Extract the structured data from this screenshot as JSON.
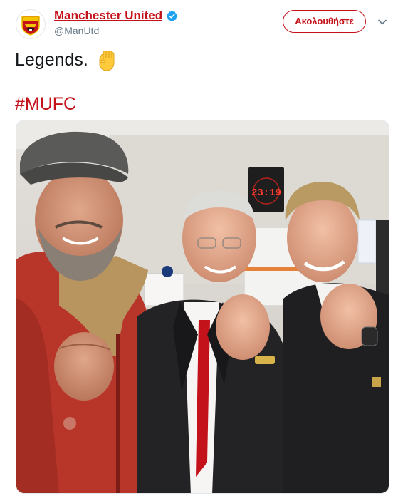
{
  "account": {
    "display_name": "Manchester United",
    "handle": "@ManUtd",
    "verified": true,
    "avatar_icon": "manutd-crest-icon"
  },
  "follow_button": {
    "label": "Ακολουθήστε"
  },
  "menu": {
    "icon": "chevron-down-icon"
  },
  "tweet": {
    "text": "Legends.",
    "emoji_icon": "raised-fist-icon",
    "hashtag": "#MUFC"
  },
  "photo": {
    "clock_display": "23:19"
  },
  "colors": {
    "brand": "#c4121a",
    "verified_badge": "#1da1f2",
    "text": "#14171a",
    "secondary_text": "#657786"
  }
}
